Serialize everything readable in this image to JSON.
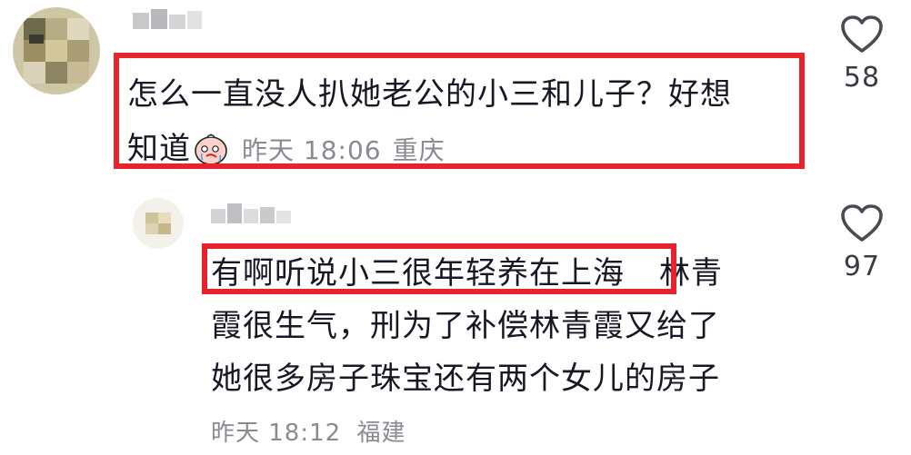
{
  "comment1": {
    "text_line1": "怎么一直没人扒她老公的小三和儿子？好想",
    "text_line2": "知道",
    "emoji": "crying-face-sticker",
    "time": "昨天 18:06",
    "location": "重庆",
    "likes": "58"
  },
  "reply1": {
    "highlight_text": "有啊听说小三很年轻养在上海",
    "rest_text_line1": "林青",
    "rest_text_line2": "霞很生气，刑为了补偿林青霞又给了",
    "rest_text_line3": "她很多房子珠宝还有两个女儿的房子",
    "time": "昨天 18:12",
    "location": "福建",
    "likes": "97"
  },
  "colors": {
    "highlight": "#e8232d",
    "meta_text": "#8a8b91",
    "body_text": "#161823"
  },
  "icons": {
    "like": "heart-outline-icon"
  }
}
